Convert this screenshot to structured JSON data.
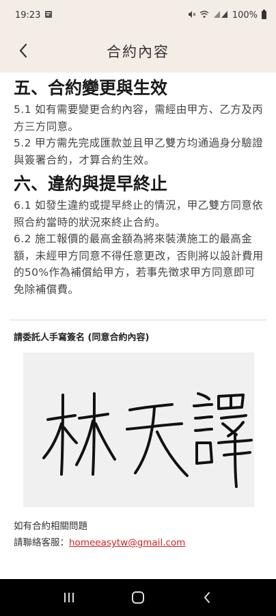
{
  "status_bar": {
    "time": "19:23",
    "battery": "100%",
    "icons": [
      "notification-icon",
      "mute-icon",
      "wifi-icon",
      "signal-icon",
      "battery-icon"
    ]
  },
  "app_bar": {
    "title": "合約內容",
    "back_icon": "back-chevron-icon"
  },
  "sections": [
    {
      "heading": "五、合約變更與生效",
      "paragraphs": [
        "5.1 如有需要變更合約內容，需經由甲方、乙方及丙方三方同意。",
        "5.2 甲方需先完成匯款並且甲乙雙方均通過身分驗證與簽署合約，才算合約生效。"
      ]
    },
    {
      "heading": "六、違約與提早終止",
      "paragraphs": [
        "6.1 如發生違約或提早終止的情況，甲乙雙方同意依照合約當時的狀況來終止合約。",
        "6.2 施工報價的最高金額為將來裝潢施工的最高金額，未經甲方同意不得任意更改，否則將以設計費用的50%作為補償給甲方，若事先徵求甲方同意即可免除補償費。"
      ]
    }
  ],
  "signature": {
    "label": "請委託人手寫簽名 (同意合約內容)",
    "signed_text": "林天譯"
  },
  "footer": {
    "line1": "如有合約相關問題",
    "contact_prefix": "請聯絡客服：",
    "email": "homeeasytw@gmail.com"
  },
  "nav_bar": {
    "icons": [
      "recent-apps-icon",
      "home-icon",
      "back-icon"
    ]
  },
  "colors": {
    "header_bg": "#f3ede6",
    "link": "#d81e1e",
    "signature_bg": "#f0f0f0"
  }
}
